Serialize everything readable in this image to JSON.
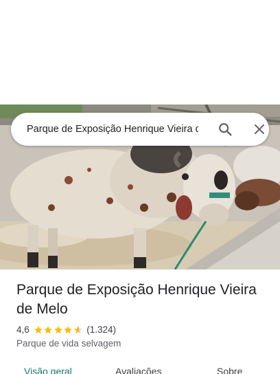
{
  "search": {
    "query": "Parque de Exposição Henrique Vieira de Melo"
  },
  "place": {
    "name": "Parque de Exposição Henrique Vieira de Melo",
    "rating": "4,6",
    "rating_value": 4.6,
    "review_count": "(1.324)",
    "category": "Parque de vida selvagem"
  },
  "tabs": [
    {
      "label": "Visão geral",
      "selected": true
    },
    {
      "label": "Avaliações",
      "selected": false
    },
    {
      "label": "Sobre",
      "selected": false
    }
  ],
  "icons": {
    "search": "search-icon",
    "close": "close-icon",
    "star": "star-icon"
  },
  "colors": {
    "star": "#fbbc04",
    "accent_tab": "#0b7a74",
    "text_primary": "#202124",
    "text_secondary": "#5f6368"
  }
}
